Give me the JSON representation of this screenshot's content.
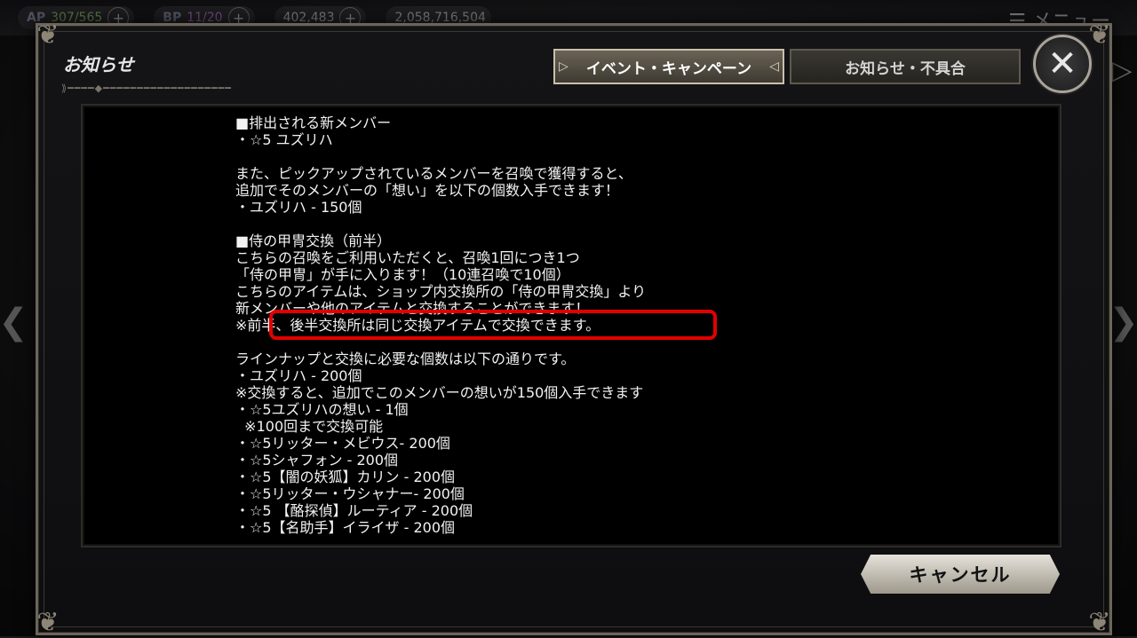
{
  "topbar": {
    "ap": {
      "label": "AP",
      "value": "307/565"
    },
    "bp": {
      "label": "BP",
      "value": "11/20"
    },
    "currency1": {
      "value": "402,483"
    },
    "currency2": {
      "value": "2,058,716,504"
    },
    "menu": "メニュー"
  },
  "dialog": {
    "title": "お知らせ",
    "tabs": [
      {
        "label": "イベント・キャンペーン",
        "active": true
      },
      {
        "label": "お知らせ・不具合",
        "active": false
      }
    ],
    "close_icon": "close-x-icon",
    "cancel_label": "キャンセル"
  },
  "notice_lines": [
    "■排出される新メンバー",
    "・☆5 ユズリハ",
    "",
    "また、ピックアップされているメンバーを召喚で獲得すると、",
    "追加でそのメンバーの「想い」を以下の個数入手できます！",
    "・ユズリハ - 150個",
    "",
    "■侍の甲冑交換（前半）",
    "こちらの召喚をご利用いただくと、召喚1回につき1つ",
    "「侍の甲冑」が手に入ります！（10連召喚で10個）",
    "こちらのアイテムは、ショップ内交換所の「侍の甲冑交換」より",
    "新メンバーや他のアイテムと交換することができます！",
    "※前半、後半交換所は同じ交換アイテムで交換できます。",
    "",
    "ラインナップと交換に必要な個数は以下の通りです。",
    "・ユズリハ - 200個",
    "※交換すると、追加でこのメンバーの想いが150個入手できます",
    "・☆5ユズリハの想い - 1個",
    "  ※100回まで交換可能",
    "・☆5リッター・メビウス- 200個",
    "・☆5シャフォン - 200個",
    "・☆5【闇の妖狐】カリン - 200個",
    "・☆5リッター・ウシャナー- 200個",
    "・☆5 【酪探偵】ルーティア - 200個",
    "・☆5【名助手】イライザ - 200個"
  ],
  "colors": {
    "highlight": "#e30000",
    "frame": "#6b655b",
    "panel": "#000000"
  }
}
